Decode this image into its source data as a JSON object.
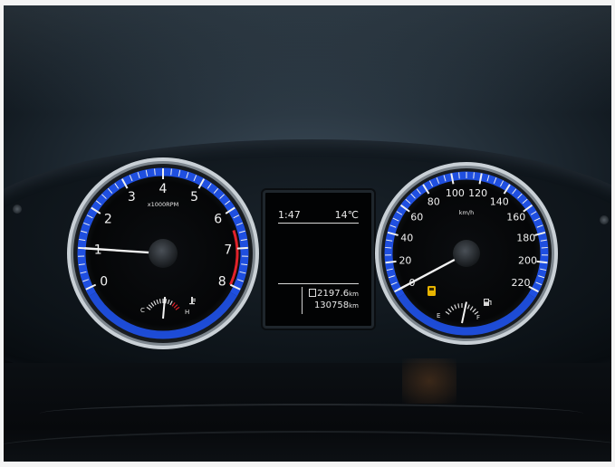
{
  "tachometer": {
    "unit_label": "x1000RPM",
    "scale": [
      "0",
      "1",
      "2",
      "3",
      "4",
      "5",
      "6",
      "7",
      "8"
    ],
    "needle_value": 1.0,
    "temp_low": "C",
    "temp_high": "H"
  },
  "speedometer": {
    "unit_label": "km/h",
    "scale": [
      "0",
      "20",
      "40",
      "60",
      "80",
      "100",
      "120",
      "140",
      "160",
      "180",
      "200",
      "220"
    ],
    "needle_value": 0,
    "fuel_empty": "E",
    "fuel_full": "F"
  },
  "display": {
    "clock": "1:47",
    "temperature": "14℃",
    "trip": "2197.6",
    "trip_unit": "km",
    "odometer": "130758",
    "odometer_unit": "km"
  },
  "colors": {
    "accent_blue": "#1f4fe0",
    "redline": "#e0222a",
    "needle": "#f2f2f2",
    "fuel_warning": "#e8b400"
  },
  "icons": [
    "coolant-temp-icon",
    "fuel-warning-icon",
    "fuel-pump-icon",
    "trip-icon"
  ]
}
